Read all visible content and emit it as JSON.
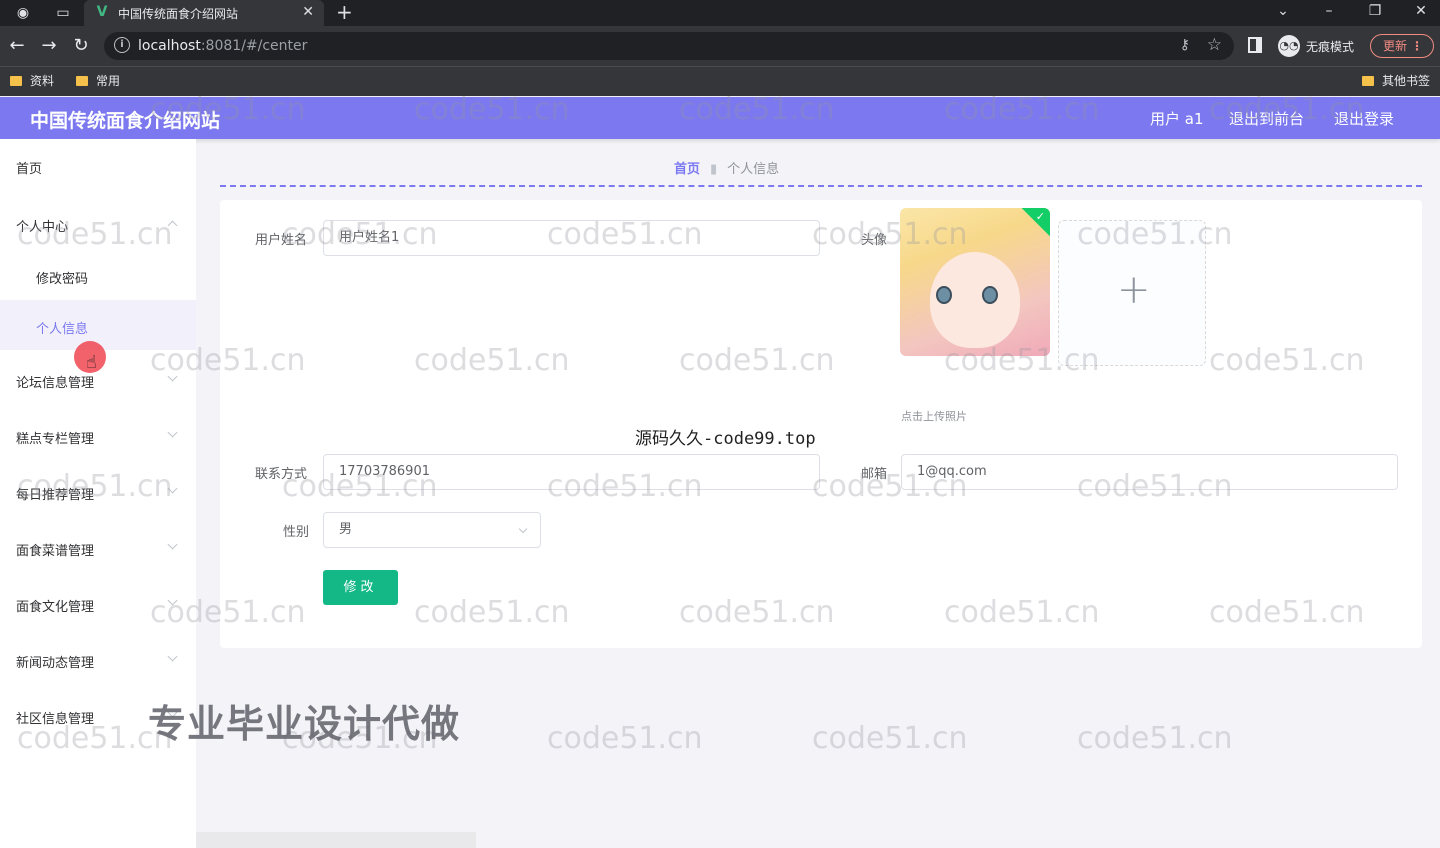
{
  "browser": {
    "tab_title": "中国传统面食介绍网站",
    "tab_favicon": "V",
    "url_host": "localhost",
    "url_rest": ":8081/#/center",
    "incognito_label": "无痕模式",
    "update_label": "更新",
    "bookmarks": [
      "资料",
      "常用"
    ],
    "bookmarks_other": "其他书签"
  },
  "header": {
    "site_title": "中国传统面食介绍网站",
    "user_label": "用户 a1",
    "to_frontend": "退出到前台",
    "logout": "退出登录",
    "bg_color": "#7b78f0"
  },
  "sidebar": {
    "items": [
      {
        "label": "首页"
      },
      {
        "label": "个人中心"
      },
      {
        "label": "修改密码"
      },
      {
        "label": "个人信息"
      },
      {
        "label": "论坛信息管理"
      },
      {
        "label": "糕点专栏管理"
      },
      {
        "label": "每日推荐管理"
      },
      {
        "label": "面食菜谱管理"
      },
      {
        "label": "面食文化管理"
      },
      {
        "label": "新闻动态管理"
      },
      {
        "label": "社区信息管理"
      }
    ],
    "active_item": "个人信息"
  },
  "breadcrumb": {
    "home": "首页",
    "current": "个人信息"
  },
  "form": {
    "username_label": "用户姓名",
    "username_value": "用户姓名1",
    "avatar_label": "头像",
    "upload_tip": "点击上传照片",
    "contact_label": "联系方式",
    "contact_value": "17703786901",
    "email_label": "邮箱",
    "email_value": "1@qq.com",
    "gender_label": "性别",
    "gender_value": "男",
    "submit_label": "修改"
  },
  "overlay": {
    "watermark": "code51.cn",
    "center_note": "源码久久-code99.top",
    "promo": "专业毕业设计代做"
  },
  "colors": {
    "accent": "#7b78f0",
    "button": "#13b886"
  }
}
